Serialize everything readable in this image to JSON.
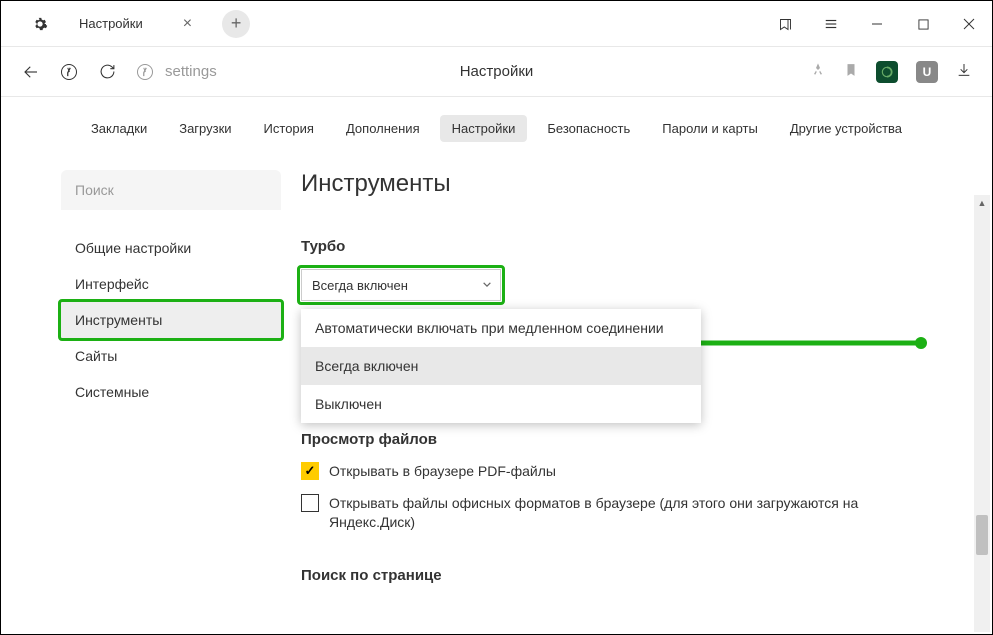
{
  "window": {
    "tab_title": "Настройки",
    "bookmark_icon": "bookmark",
    "menu_icon": "menu"
  },
  "toolbar": {
    "url": "settings",
    "page_title": "Настройки"
  },
  "top_tabs": [
    {
      "label": "Закладки",
      "active": false
    },
    {
      "label": "Загрузки",
      "active": false
    },
    {
      "label": "История",
      "active": false
    },
    {
      "label": "Дополнения",
      "active": false
    },
    {
      "label": "Настройки",
      "active": true
    },
    {
      "label": "Безопасность",
      "active": false
    },
    {
      "label": "Пароли и карты",
      "active": false
    },
    {
      "label": "Другие устройства",
      "active": false
    }
  ],
  "sidebar": {
    "search_placeholder": "Поиск",
    "items": [
      {
        "label": "Общие настройки",
        "active": false
      },
      {
        "label": "Интерфейс",
        "active": false
      },
      {
        "label": "Инструменты",
        "active": true
      },
      {
        "label": "Сайты",
        "active": false
      },
      {
        "label": "Системные",
        "active": false
      }
    ]
  },
  "main": {
    "heading": "Инструменты",
    "turbo": {
      "title": "Турбо",
      "selected": "Всегда включен",
      "options": [
        {
          "label": "Автоматически включать при медленном соединении",
          "selected": false
        },
        {
          "label": "Всегда включен",
          "selected": true
        },
        {
          "label": "Выключен",
          "selected": false
        }
      ]
    },
    "files": {
      "title": "Просмотр файлов",
      "checkboxes": [
        {
          "label": "Открывать в браузере PDF-файлы",
          "checked": true
        },
        {
          "label": "Открывать файлы офисных форматов в браузере (для этого они загружаются на Яндекс.Диск)",
          "checked": false
        }
      ]
    },
    "page_search": {
      "title": "Поиск по странице"
    }
  },
  "ext_badge_u": "U"
}
